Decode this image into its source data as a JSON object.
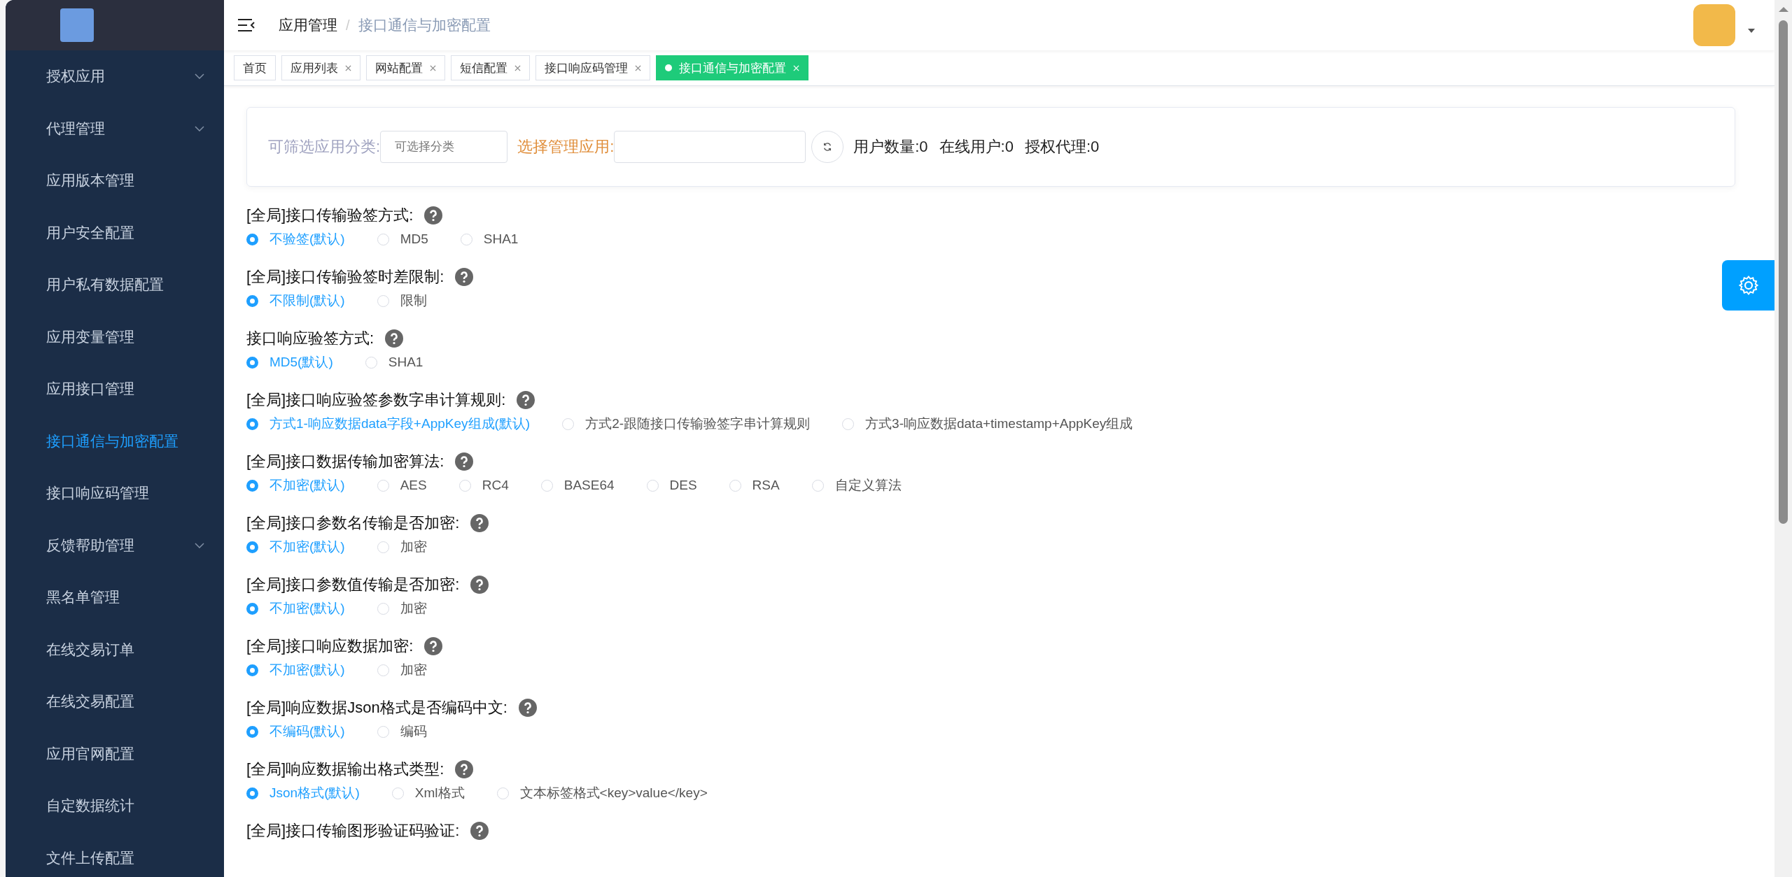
{
  "sidebar": {
    "items": [
      {
        "label": "授权应用",
        "expandable": true,
        "selected": false
      },
      {
        "label": "代理管理",
        "expandable": true,
        "selected": false
      },
      {
        "label": "应用版本管理",
        "expandable": false,
        "selected": false
      },
      {
        "label": "用户安全配置",
        "expandable": false,
        "selected": false
      },
      {
        "label": "用户私有数据配置",
        "expandable": false,
        "selected": false
      },
      {
        "label": "应用变量管理",
        "expandable": false,
        "selected": false
      },
      {
        "label": "应用接口管理",
        "expandable": false,
        "selected": false
      },
      {
        "label": "接口通信与加密配置",
        "expandable": false,
        "selected": true
      },
      {
        "label": "接口响应码管理",
        "expandable": false,
        "selected": false
      },
      {
        "label": "反馈帮助管理",
        "expandable": true,
        "selected": false
      },
      {
        "label": "黑名单管理",
        "expandable": false,
        "selected": false
      },
      {
        "label": "在线交易订单",
        "expandable": false,
        "selected": false
      },
      {
        "label": "在线交易配置",
        "expandable": false,
        "selected": false
      },
      {
        "label": "应用官网配置",
        "expandable": false,
        "selected": false
      },
      {
        "label": "自定数据统计",
        "expandable": false,
        "selected": false
      },
      {
        "label": "文件上传配置",
        "expandable": false,
        "selected": false
      }
    ]
  },
  "breadcrumb": {
    "items": [
      "应用管理",
      "接口通信与加密配置"
    ],
    "separator": "/"
  },
  "tabs": [
    {
      "label": "首页",
      "closable": false,
      "selected": false
    },
    {
      "label": "应用列表",
      "closable": true,
      "selected": false
    },
    {
      "label": "网站配置",
      "closable": true,
      "selected": false
    },
    {
      "label": "短信配置",
      "closable": true,
      "selected": false
    },
    {
      "label": "接口响应码管理",
      "closable": true,
      "selected": false
    },
    {
      "label": "接口通信与加密配置",
      "closable": true,
      "selected": true
    }
  ],
  "filter": {
    "category_label": "可筛选应用分类:",
    "category_placeholder": "可选择分类",
    "app_label": "选择管理应用:",
    "stats": [
      "用户数量:0",
      "在线用户:0",
      "授权代理:0"
    ]
  },
  "settings": [
    {
      "label": "[全局]接口传输验签方式:",
      "options": [
        {
          "label": "不验签(默认)",
          "selected": true
        },
        {
          "label": "MD5",
          "selected": false
        },
        {
          "label": "SHA1",
          "selected": false
        }
      ]
    },
    {
      "label": "[全局]接口传输验签时差限制:",
      "options": [
        {
          "label": "不限制(默认)",
          "selected": true
        },
        {
          "label": "限制",
          "selected": false
        }
      ]
    },
    {
      "label": "接口响应验签方式:",
      "options": [
        {
          "label": "MD5(默认)",
          "selected": true
        },
        {
          "label": "SHA1",
          "selected": false
        }
      ]
    },
    {
      "label": "[全局]接口响应验签参数字串计算规则:",
      "options": [
        {
          "label": "方式1-响应数据data字段+AppKey组成(默认)",
          "selected": true
        },
        {
          "label": "方式2-跟随接口传输验签字串计算规则",
          "selected": false
        },
        {
          "label": "方式3-响应数据data+timestamp+AppKey组成",
          "selected": false
        }
      ]
    },
    {
      "label": "[全局]接口数据传输加密算法:",
      "options": [
        {
          "label": "不加密(默认)",
          "selected": true
        },
        {
          "label": "AES",
          "selected": false
        },
        {
          "label": "RC4",
          "selected": false
        },
        {
          "label": "BASE64",
          "selected": false
        },
        {
          "label": "DES",
          "selected": false
        },
        {
          "label": "RSA",
          "selected": false
        },
        {
          "label": "自定义算法",
          "selected": false
        }
      ]
    },
    {
      "label": "[全局]接口参数名传输是否加密:",
      "options": [
        {
          "label": "不加密(默认)",
          "selected": true
        },
        {
          "label": "加密",
          "selected": false
        }
      ]
    },
    {
      "label": "[全局]接口参数值传输是否加密:",
      "options": [
        {
          "label": "不加密(默认)",
          "selected": true
        },
        {
          "label": "加密",
          "selected": false
        }
      ]
    },
    {
      "label": "[全局]接口响应数据加密:",
      "options": [
        {
          "label": "不加密(默认)",
          "selected": true
        },
        {
          "label": "加密",
          "selected": false
        }
      ]
    },
    {
      "label": "[全局]响应数据Json格式是否编码中文:",
      "options": [
        {
          "label": "不编码(默认)",
          "selected": true
        },
        {
          "label": "编码",
          "selected": false
        }
      ]
    },
    {
      "label": "[全局]响应数据输出格式类型:",
      "options": [
        {
          "label": "Json格式(默认)",
          "selected": true
        },
        {
          "label": "Xml格式",
          "selected": false
        },
        {
          "label": "文本标签格式<key>value</key>",
          "selected": false
        }
      ]
    },
    {
      "label": "[全局]接口传输图形验证码验证:"
    }
  ]
}
